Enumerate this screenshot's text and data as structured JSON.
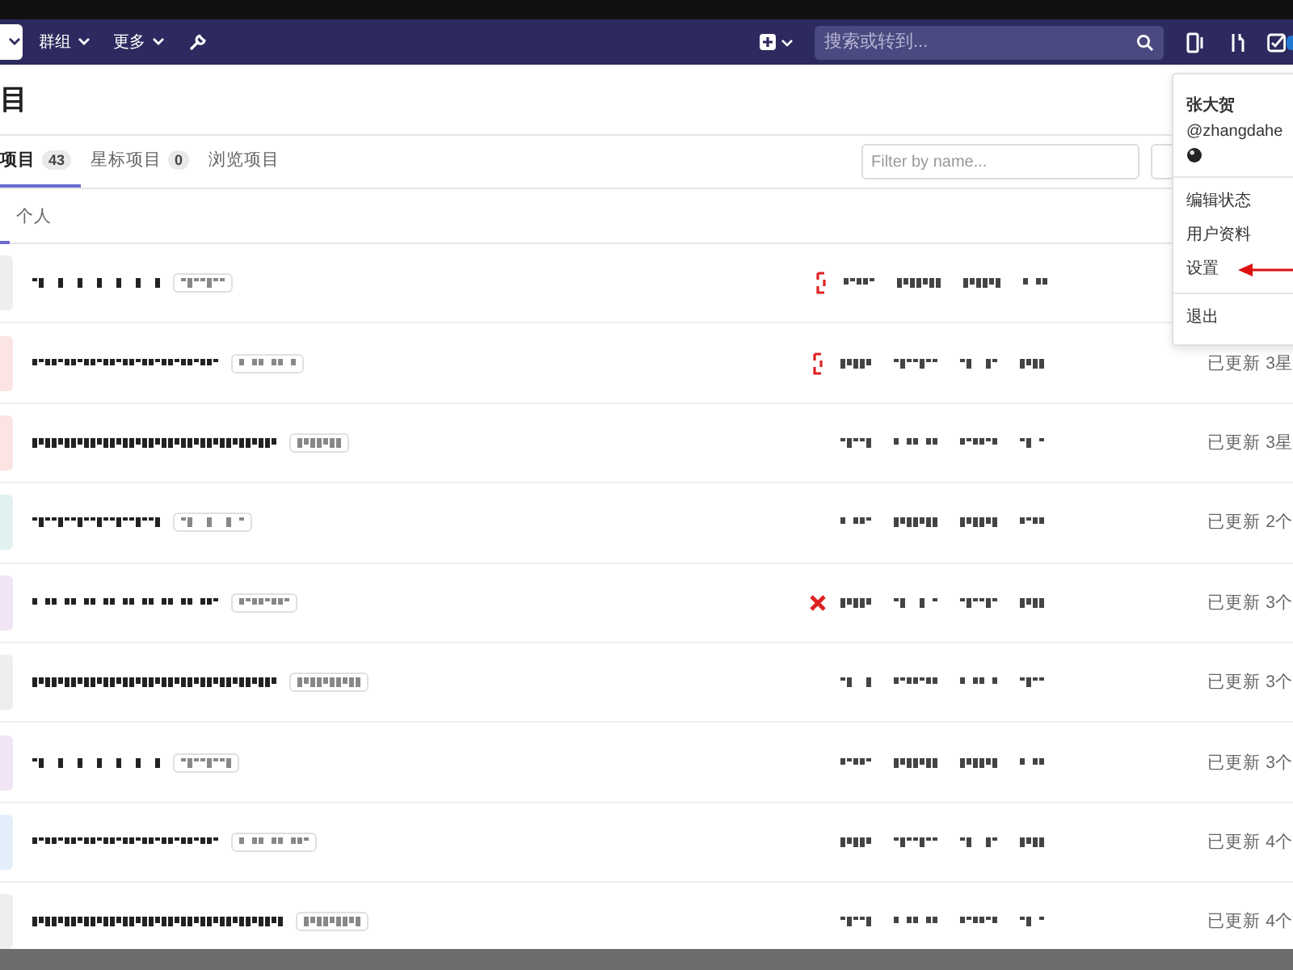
{
  "navbar": {
    "menus": [
      {
        "label": "群组"
      },
      {
        "label": "更多"
      }
    ],
    "search": {
      "placeholder": "搜索或转到..."
    }
  },
  "page_title": "目",
  "tabs": [
    {
      "label": "项目",
      "count": "43",
      "selected": true
    },
    {
      "label": "星标项目",
      "count": "0",
      "selected": false
    },
    {
      "label": "浏览项目",
      "selected": false
    }
  ],
  "filter": {
    "placeholder": "Filter by name..."
  },
  "subtabs": [
    {
      "label": "个人",
      "selected": false
    }
  ],
  "projects": [
    {
      "color": "#eeeeee",
      "warning": true,
      "failed": false
    },
    {
      "color": "#fbe4e1",
      "warning": true,
      "failed": false,
      "updated": "已更新 3星"
    },
    {
      "color": "#fbe4e1",
      "warning": false,
      "failed": false,
      "updated": "已更新 3星"
    },
    {
      "color": "#e0f1ef",
      "warning": false,
      "failed": false,
      "updated": "已更新 2个"
    },
    {
      "color": "#f1e4f5",
      "warning": false,
      "failed": true,
      "updated": "已更新 3个"
    },
    {
      "color": "#eeeeee",
      "warning": false,
      "failed": false,
      "updated": "已更新 3个"
    },
    {
      "color": "#f1e4f5",
      "warning": false,
      "failed": false,
      "updated": "已更新 3个"
    },
    {
      "color": "#e2effb",
      "warning": false,
      "failed": false,
      "updated": "已更新 4个"
    },
    {
      "color": "#eeeeee",
      "warning": false,
      "failed": false,
      "updated": "已更新 4个"
    }
  ],
  "user_menu": {
    "name": "张大贺",
    "handle": "@zhangdahe",
    "items": [
      {
        "label": "编辑状态",
        "highlighted": false
      },
      {
        "label": "用户资料",
        "highlighted": false
      },
      {
        "label": "设置",
        "highlighted": true
      },
      {
        "label": "退出",
        "highlighted": false
      }
    ]
  }
}
